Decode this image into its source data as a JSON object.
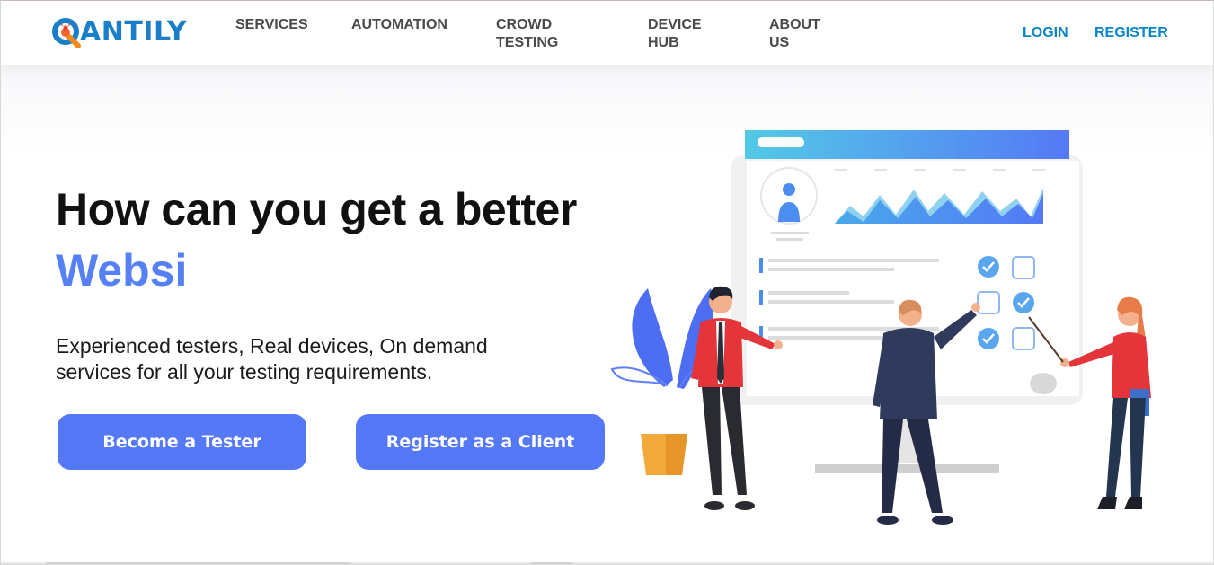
{
  "brand": {
    "name": "ANTILY",
    "primary_color": "#1a7ec8",
    "accent_color": "#5680f6"
  },
  "nav": {
    "items": [
      {
        "label": "SERVICES"
      },
      {
        "label": "AUTOMATION"
      },
      {
        "label": "CROWD TESTING"
      },
      {
        "label": "DEVICE HUB"
      },
      {
        "label": "ABOUT US"
      }
    ],
    "login": "LOGIN",
    "register": "REGISTER"
  },
  "hero": {
    "headline": "How can you get a better",
    "headline_accent": "Websi",
    "subtext": "Experienced testers, Real devices, On demand services for all your testing requirements.",
    "cta_primary": "Become a Tester",
    "cta_secondary": "Register as a Client"
  },
  "icons": {
    "logo": "qantily-logo-icon",
    "illustration": "team-dashboard-illustration"
  }
}
